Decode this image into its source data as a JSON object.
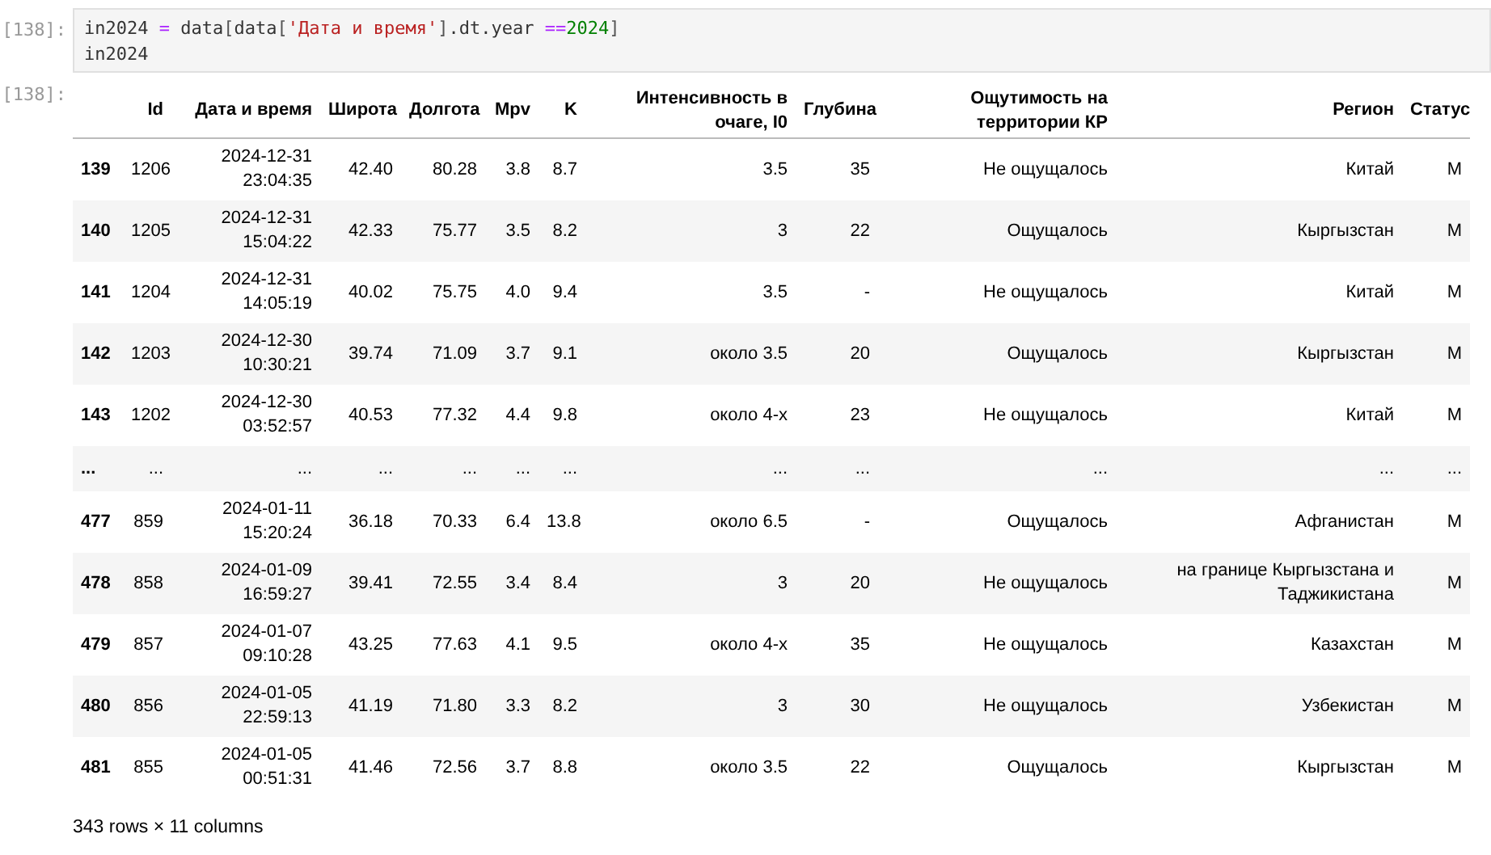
{
  "input_cell": {
    "prompt": "[138]:",
    "lines": [
      [
        {
          "kind": "name",
          "text": "in2024"
        },
        {
          "kind": "op",
          "text": " = "
        },
        {
          "kind": "name",
          "text": "data"
        },
        {
          "kind": "punc",
          "text": "["
        },
        {
          "kind": "name",
          "text": "data"
        },
        {
          "kind": "punc",
          "text": "["
        },
        {
          "kind": "str",
          "text": "'Дата и время'"
        },
        {
          "kind": "punc",
          "text": "]"
        },
        {
          "kind": "name",
          "text": ".dt.year "
        },
        {
          "kind": "op",
          "text": "=="
        },
        {
          "kind": "num",
          "text": "2024"
        },
        {
          "kind": "punc",
          "text": "]"
        }
      ],
      [
        {
          "kind": "name",
          "text": "in2024"
        }
      ]
    ]
  },
  "output_cell": {
    "prompt": "[138]:",
    "table": {
      "columns": [
        "Id",
        "Дата и время",
        "Широта",
        "Долгота",
        "Mpv",
        "K",
        "Интенсивность в очаге, I0",
        "Глубина",
        "Ощутимость на территории КР",
        "Регион",
        "Статус"
      ],
      "rows": [
        {
          "kind": "data",
          "index": "139",
          "cells": [
            "1206",
            "2024-12-31 23:04:35",
            "42.40",
            "80.28",
            "3.8",
            "8.7",
            "3.5",
            "35",
            "Не ощущалось",
            "Китай",
            "M"
          ]
        },
        {
          "kind": "data",
          "index": "140",
          "cells": [
            "1205",
            "2024-12-31 15:04:22",
            "42.33",
            "75.77",
            "3.5",
            "8.2",
            "3",
            "22",
            "Ощущалось",
            "Кыргызстан",
            "M"
          ]
        },
        {
          "kind": "data",
          "index": "141",
          "cells": [
            "1204",
            "2024-12-31 14:05:19",
            "40.02",
            "75.75",
            "4.0",
            "9.4",
            "3.5",
            "-",
            "Не ощущалось",
            "Китай",
            "M"
          ]
        },
        {
          "kind": "data",
          "index": "142",
          "cells": [
            "1203",
            "2024-12-30 10:30:21",
            "39.74",
            "71.09",
            "3.7",
            "9.1",
            "около 3.5",
            "20",
            "Ощущалось",
            "Кыргызстан",
            "M"
          ]
        },
        {
          "kind": "data",
          "index": "143",
          "cells": [
            "1202",
            "2024-12-30 03:52:57",
            "40.53",
            "77.32",
            "4.4",
            "9.8",
            "около 4-х",
            "23",
            "Не ощущалось",
            "Китай",
            "M"
          ]
        },
        {
          "kind": "ellipsis",
          "index": "...",
          "cells": [
            "...",
            "...",
            "...",
            "...",
            "...",
            "...",
            "...",
            "...",
            "...",
            "...",
            "..."
          ]
        },
        {
          "kind": "data",
          "index": "477",
          "cells": [
            "859",
            "2024-01-11 15:20:24",
            "36.18",
            "70.33",
            "6.4",
            "13.8",
            "около 6.5",
            "-",
            "Ощущалось",
            "Афганистан",
            "M"
          ]
        },
        {
          "kind": "data",
          "index": "478",
          "cells": [
            "858",
            "2024-01-09 16:59:27",
            "39.41",
            "72.55",
            "3.4",
            "8.4",
            "3",
            "20",
            "Не ощущалось",
            "на границе Кыргызстана и Таджикистана",
            "M"
          ]
        },
        {
          "kind": "data",
          "index": "479",
          "cells": [
            "857",
            "2024-01-07 09:10:28",
            "43.25",
            "77.63",
            "4.1",
            "9.5",
            "около 4-х",
            "35",
            "Не ощущалось",
            "Казахстан",
            "M"
          ]
        },
        {
          "kind": "data",
          "index": "480",
          "cells": [
            "856",
            "2024-01-05 22:59:13",
            "41.19",
            "71.80",
            "3.3",
            "8.2",
            "3",
            "30",
            "Не ощущалось",
            "Узбекистан",
            "M"
          ]
        },
        {
          "kind": "data",
          "index": "481",
          "cells": [
            "855",
            "2024-01-05 00:51:31",
            "41.46",
            "72.56",
            "3.7",
            "8.8",
            "около 3.5",
            "22",
            "Ощущалось",
            "Кыргызстан",
            "M"
          ]
        }
      ]
    },
    "summary": "343 rows × 11 columns"
  }
}
